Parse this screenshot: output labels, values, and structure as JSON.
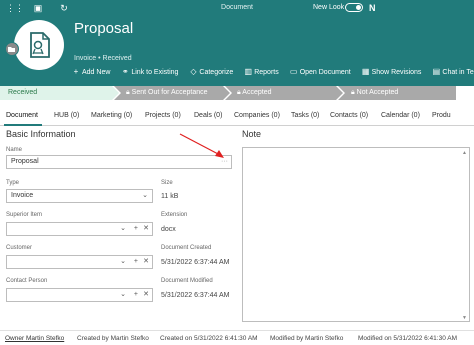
{
  "window": {
    "title": "Document",
    "new_look_label": "New Look",
    "new_look_on": true,
    "logo_letter": "N"
  },
  "record": {
    "title": "Proposal",
    "subtitle": "Invoice • Received"
  },
  "actions": [
    {
      "icon": "+",
      "label": "Add New"
    },
    {
      "icon": "⚭",
      "label": "Link to Existing"
    },
    {
      "icon": "◇",
      "label": "Categorize"
    },
    {
      "icon": "▥",
      "label": "Reports"
    },
    {
      "icon": "▭",
      "label": "Open Document"
    },
    {
      "icon": "▦",
      "label": "Show Revisions"
    },
    {
      "icon": "▤",
      "label": "Chat in Te"
    }
  ],
  "stages": [
    {
      "label": "Received",
      "state": "active"
    },
    {
      "label": "Sent Out for Acceptance",
      "state": "inactive",
      "locked": true
    },
    {
      "label": "Accepted",
      "state": "inactive",
      "locked": true
    },
    {
      "label": "Not Accepted",
      "state": "inactive",
      "locked": true
    }
  ],
  "tabs": [
    "Document",
    "HUB (0)",
    "Marketing (0)",
    "Projects (0)",
    "Deals (0)",
    "Companies (0)",
    "Tasks (0)",
    "Contacts (0)",
    "Calendar (0)",
    "Produ"
  ],
  "form": {
    "section_title": "Basic Information",
    "note_title": "Note",
    "name_label": "Name",
    "name_value": "Proposal",
    "type_label": "Type",
    "type_value": "Invoice",
    "superior_label": "Superior Item",
    "customer_label": "Customer",
    "contact_label": "Contact Person",
    "size_label": "Size",
    "size_value": "11 kB",
    "extension_label": "Extension",
    "extension_value": "docx",
    "created_label": "Document Created",
    "created_value": "5/31/2022 6:37:44 AM",
    "modified_label": "Document Modified",
    "modified_value": "5/31/2022 6:37:44 AM"
  },
  "footer": {
    "owner": "Owner Martin Stefko",
    "created_by": "Created by Martin Stefko",
    "created_on": "Created on 5/31/2022 6:41:30 AM",
    "modified_by": "Modified by Martin Stefko",
    "modified_on": "Modified on 5/31/2022 6:41:30 AM"
  },
  "colors": {
    "header_teal": "#217b7b",
    "stage_active_bg": "#dff3ea",
    "stage_inactive_bg": "#a9a9a9",
    "annotation_arrow": "#e02020"
  },
  "icons": {
    "grid": "grid-icon",
    "save": "save-icon",
    "refresh": "refresh-icon",
    "document": "document-icon",
    "lock": "lock-icon",
    "dropdown": "chevron-down-icon",
    "clear": "close-icon"
  }
}
